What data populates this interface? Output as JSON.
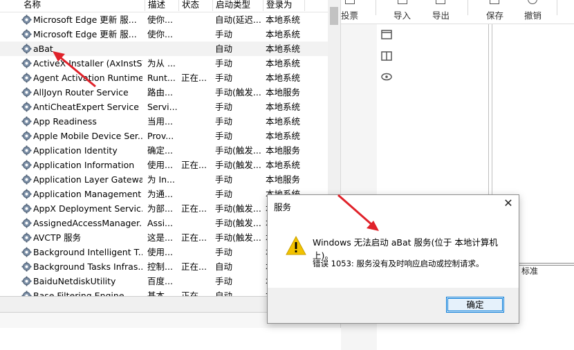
{
  "services": {
    "columns": {
      "name": "名称",
      "desc": "描述",
      "state": "状态",
      "startup": "启动类型",
      "logon": "登录为"
    },
    "rows": [
      {
        "name": "Microsoft Edge 更新 服...",
        "desc": "使你...",
        "state": "",
        "startup": "自动(延迟...",
        "logon": "本地系统"
      },
      {
        "name": "Microsoft Edge 更新 服...",
        "desc": "使你...",
        "state": "",
        "startup": "手动",
        "logon": "本地系统"
      },
      {
        "name": "aBat",
        "desc": "",
        "state": "",
        "startup": "自动",
        "logon": "本地系统"
      },
      {
        "name": "ActiveX Installer (AxInstSV)",
        "desc": "为从 ...",
        "state": "",
        "startup": "手动",
        "logon": "本地系统"
      },
      {
        "name": "Agent Activation Runtime...",
        "desc": "Runt...",
        "state": "正在...",
        "startup": "手动",
        "logon": "本地系统"
      },
      {
        "name": "AllJoyn Router Service",
        "desc": "路由...",
        "state": "",
        "startup": "手动(触发...",
        "logon": "本地服务"
      },
      {
        "name": "AntiCheatExpert Service",
        "desc": "Servi...",
        "state": "",
        "startup": "手动",
        "logon": "本地系统"
      },
      {
        "name": "App Readiness",
        "desc": "当用...",
        "state": "",
        "startup": "手动",
        "logon": "本地系统"
      },
      {
        "name": "Apple Mobile Device Ser...",
        "desc": "Prov...",
        "state": "",
        "startup": "手动",
        "logon": "本地系统"
      },
      {
        "name": "Application Identity",
        "desc": "确定...",
        "state": "",
        "startup": "手动(触发...",
        "logon": "本地服务"
      },
      {
        "name": "Application Information",
        "desc": "使用...",
        "state": "正在...",
        "startup": "手动(触发...",
        "logon": "本地系统"
      },
      {
        "name": "Application Layer Gatewa...",
        "desc": "为 In...",
        "state": "",
        "startup": "手动",
        "logon": "本地服务"
      },
      {
        "name": "Application Management",
        "desc": "为通...",
        "state": "",
        "startup": "手动",
        "logon": "本地系统"
      },
      {
        "name": "AppX Deployment Servic...",
        "desc": "为部...",
        "state": "正在...",
        "startup": "手动(触发...",
        "logon": "本地系统"
      },
      {
        "name": "AssignedAccessManager...",
        "desc": "Assi...",
        "state": "",
        "startup": "手动(触发...",
        "logon": "本地系统"
      },
      {
        "name": "AVCTP 服务",
        "desc": "这是...",
        "state": "正在...",
        "startup": "手动(触发...",
        "logon": "本地服务"
      },
      {
        "name": "Background Intelligent T...",
        "desc": "使用...",
        "state": "",
        "startup": "手动",
        "logon": "本地系统"
      },
      {
        "name": "Background Tasks Infras...",
        "desc": "控制...",
        "state": "正在...",
        "startup": "自动",
        "logon": "本地系统"
      },
      {
        "name": "BaiduNetdiskUtility",
        "desc": "百度...",
        "state": "",
        "startup": "手动",
        "logon": "本地系统"
      },
      {
        "name": "Base Filtering Engine",
        "desc": "基本...",
        "state": "正在...",
        "startup": "自动",
        "logon": "本地服务"
      }
    ]
  },
  "toolbar": {
    "vote": "投票",
    "import": "导入",
    "export": "导出",
    "save": "保存",
    "undo": "撤销"
  },
  "side_tab": "标准",
  "dialog": {
    "title": "服务",
    "message": "Windows 无法启动 aBat 服务(位于 本地计算机 上)。",
    "error": "错误 1053: 服务没有及时响应启动或控制请求。",
    "ok": "确定"
  },
  "colors": {
    "arrow": "#e0222a",
    "accent": "#0078d7",
    "warning": "#f2c200"
  }
}
